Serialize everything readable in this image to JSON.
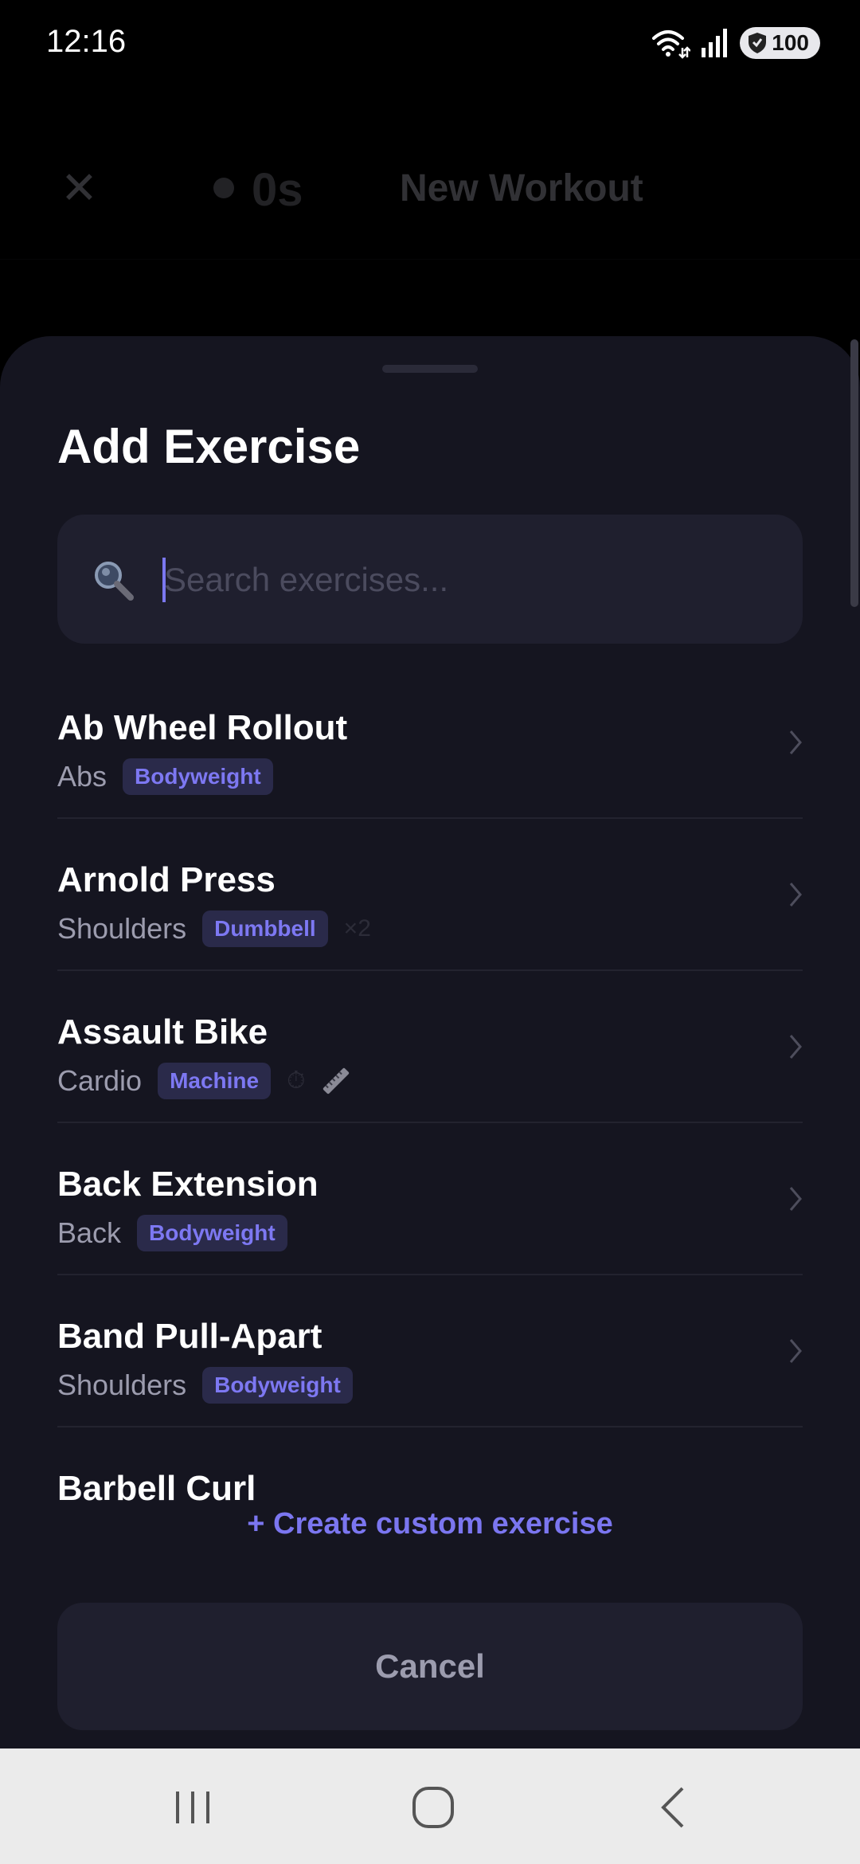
{
  "status_bar": {
    "time": "12:16",
    "battery": "100"
  },
  "workout_header": {
    "close_icon": "close-icon",
    "timer": "0s",
    "title": "New Workout"
  },
  "sheet": {
    "title": "Add Exercise",
    "search": {
      "placeholder": "Search exercises...",
      "value": ""
    },
    "exercises": [
      {
        "name": "Ab Wheel Rollout",
        "muscle": "Abs",
        "equipment": "Bodyweight",
        "extra": ""
      },
      {
        "name": "Arnold Press",
        "muscle": "Shoulders",
        "equipment": "Dumbbell",
        "extra": "×2"
      },
      {
        "name": "Assault Bike",
        "muscle": "Cardio",
        "equipment": "Machine",
        "extra": "⏱"
      },
      {
        "name": "Back Extension",
        "muscle": "Back",
        "equipment": "Bodyweight",
        "extra": ""
      },
      {
        "name": "Band Pull-Apart",
        "muscle": "Shoulders",
        "equipment": "Bodyweight",
        "extra": ""
      },
      {
        "name": "Barbell Curl",
        "muscle": "",
        "equipment": "",
        "extra": ""
      }
    ],
    "create_custom_label": "+ Create custom exercise",
    "cancel_label": "Cancel"
  },
  "colors": {
    "accent": "#7b76f0",
    "sheet_background": "#151520",
    "input_background": "#1f1f2e",
    "tag_background": "#2a2a4a",
    "muted_text": "#9c9cae"
  }
}
